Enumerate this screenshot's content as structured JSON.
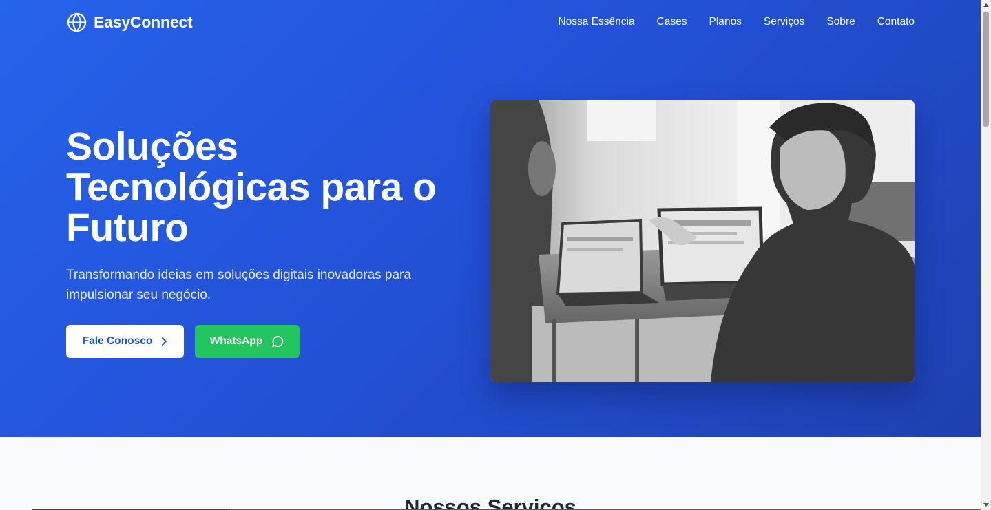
{
  "brand": {
    "name": "EasyConnect",
    "icon": "globe-icon"
  },
  "nav": {
    "links": [
      {
        "label": "Nossa Essência"
      },
      {
        "label": "Cases"
      },
      {
        "label": "Planos"
      },
      {
        "label": "Serviços"
      },
      {
        "label": "Sobre"
      },
      {
        "label": "Contato"
      }
    ]
  },
  "hero": {
    "title_line1": "Soluções",
    "title_line2": "Tecnológicas para o",
    "title_line3": "Futuro",
    "subtitle": "Transformando ideias em soluções digitais inovadoras para impulsionar seu negócio.",
    "primary_button": {
      "label": "Fale Conosco",
      "icon": "chevron-right-icon"
    },
    "whatsapp_button": {
      "label": "WhatsApp",
      "icon": "chat-bubble-icon"
    },
    "image_alt": "photo of people working on laptops at a table"
  },
  "services": {
    "title": "Nossos Serviços"
  },
  "colors": {
    "hero_start": "#2563eb",
    "hero_end": "#1e40af",
    "whatsapp": "#22c55e",
    "primary_text": "#2056d8"
  }
}
